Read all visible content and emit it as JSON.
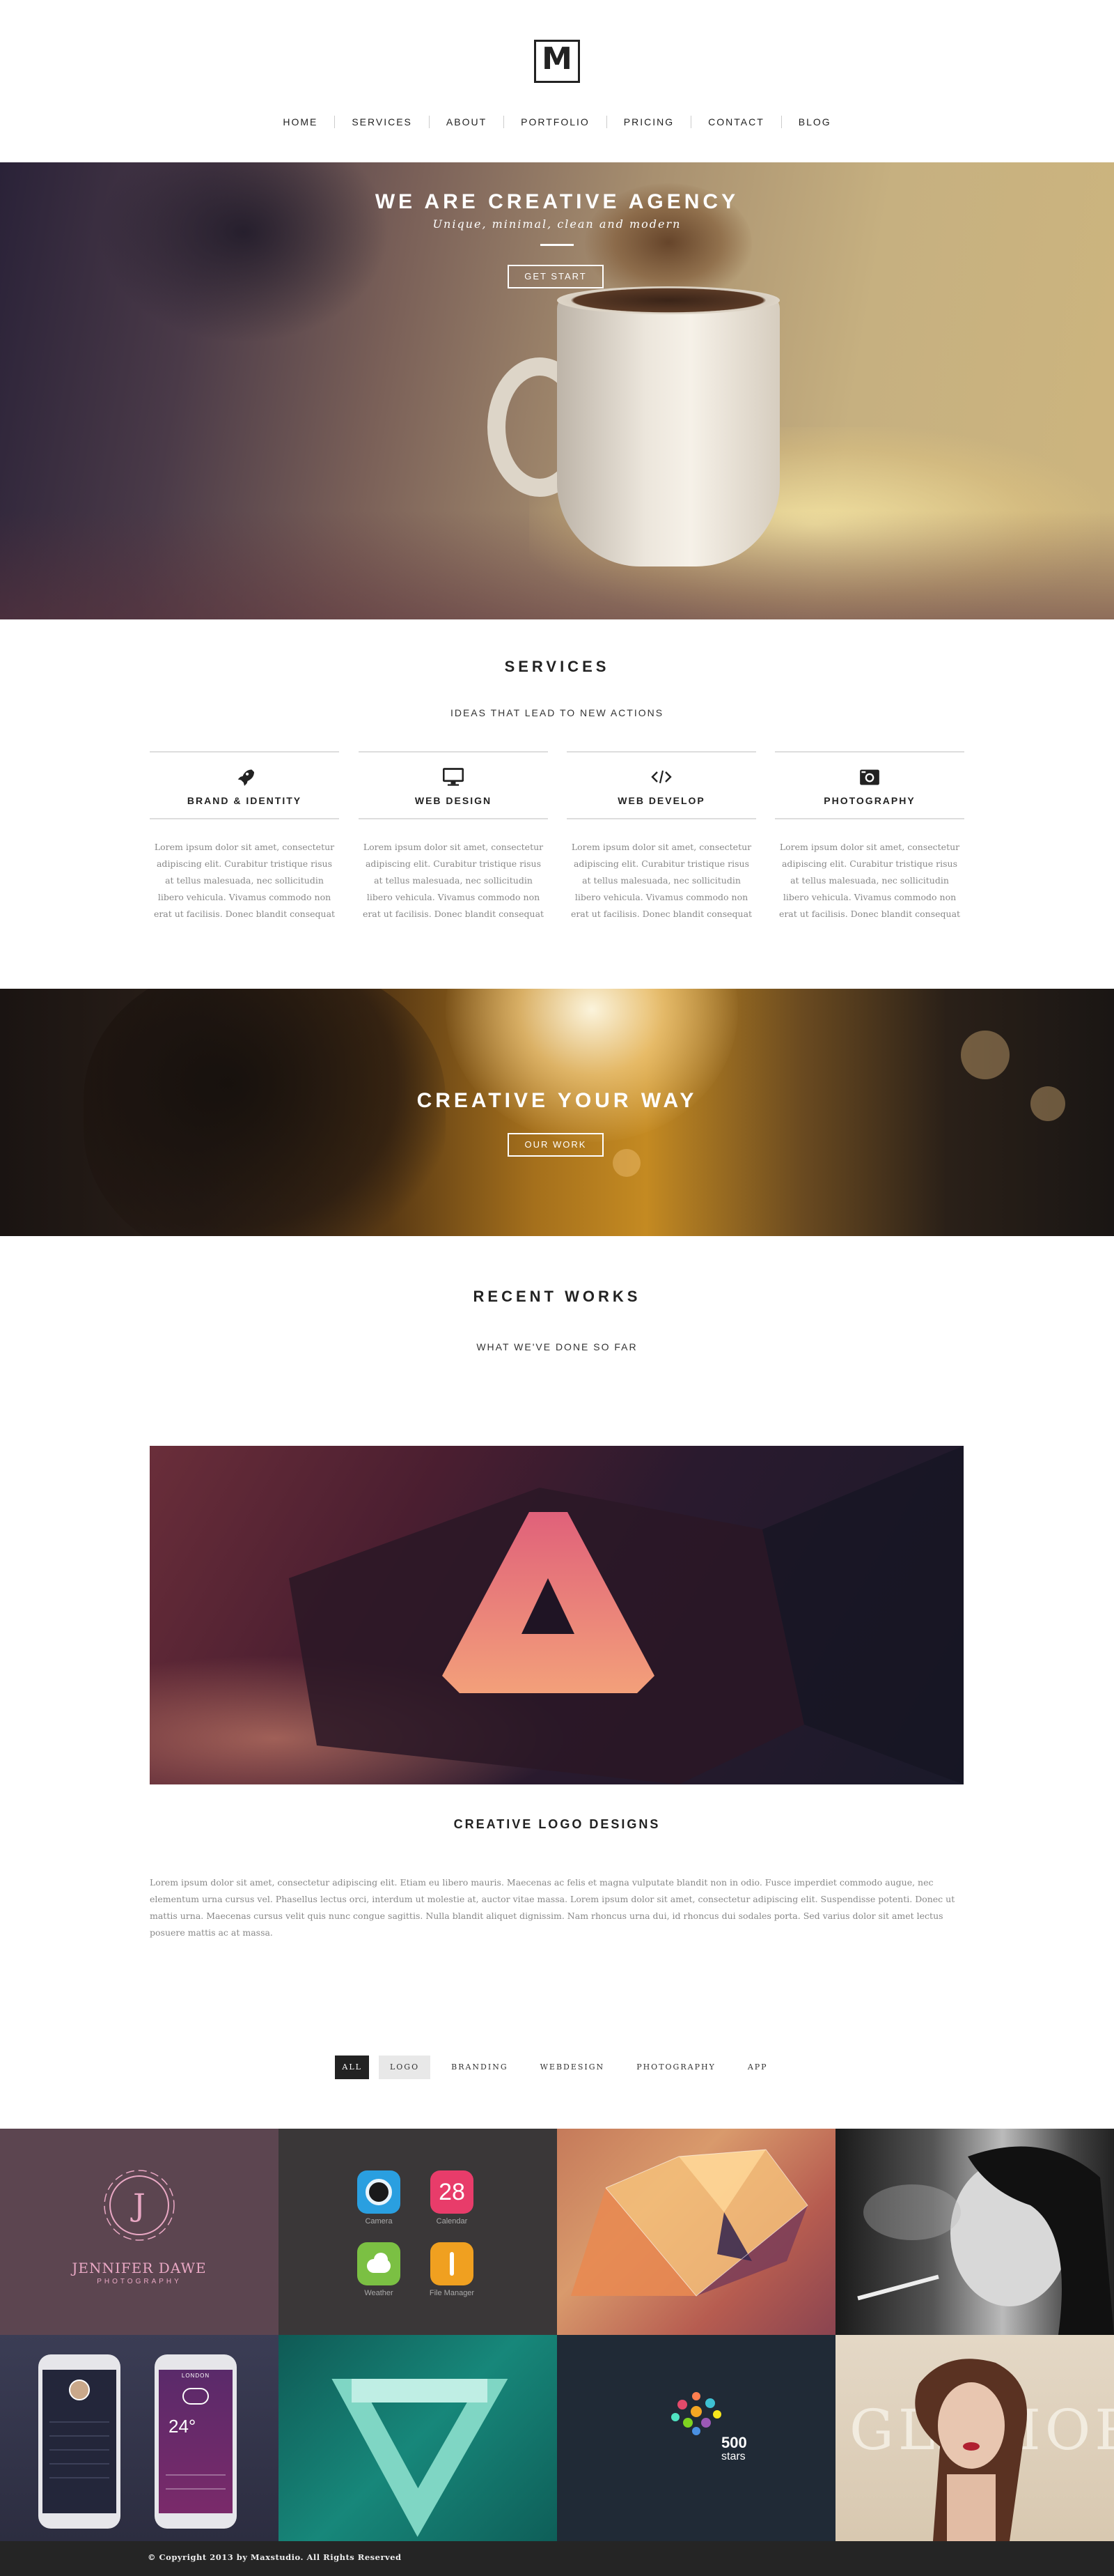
{
  "brand": {
    "logo_letter": "M"
  },
  "nav": {
    "items": [
      "HOME",
      "SERVICES",
      "ABOUT",
      "PORTFOLIO",
      "PRICING",
      "CONTACT",
      "BLOG"
    ]
  },
  "hero": {
    "title": "WE ARE CREATIVE AGENCY",
    "subtitle": "Unique, minimal, clean and modern",
    "button": "GET START"
  },
  "services": {
    "title": "SERVICES",
    "subtitle": "IDEAS THAT LEAD TO NEW ACTIONS",
    "items": [
      {
        "icon": "rocket-icon",
        "name": "BRAND & IDENTITY",
        "text": "Lorem ipsum dolor sit amet, consectetur adipiscing elit. Curabitur tristique risus at tellus malesuada, nec sollicitudin libero vehicula. Vivamus commodo non erat ut facilisis. Donec blandit consequat"
      },
      {
        "icon": "monitor-icon",
        "name": "WEB DESIGN",
        "text": "Lorem ipsum dolor sit amet, consectetur adipiscing elit. Curabitur tristique risus at tellus malesuada, nec sollicitudin libero vehicula. Vivamus commodo non erat ut facilisis. Donec blandit consequat"
      },
      {
        "icon": "code-icon",
        "name": "WEB DEVELOP",
        "text": "Lorem ipsum dolor sit amet, consectetur adipiscing elit. Curabitur tristique risus at tellus malesuada, nec sollicitudin libero vehicula. Vivamus commodo non erat ut facilisis. Donec blandit consequat"
      },
      {
        "icon": "camera-icon",
        "name": "PHOTOGRAPHY",
        "text": "Lorem ipsum dolor sit amet, consectetur adipiscing elit. Curabitur tristique risus at tellus malesuada, nec sollicitudin libero vehicula. Vivamus commodo non erat ut facilisis. Donec blandit consequat"
      }
    ]
  },
  "band": {
    "title": "CREATIVE YOUR WAY",
    "button": "OUR WORK"
  },
  "recent": {
    "title": "RECENT WORKS",
    "subtitle": "WHAT WE'VE DONE SO FAR",
    "feature_title": "CREATIVE LOGO DESIGNS",
    "feature_text": "Lorem ipsum dolor sit amet, consectetur adipiscing elit. Etiam eu libero mauris. Maecenas ac felis et magna vulputate blandit non in odio. Fusce imperdiet commodo augue, nec elementum urna cursus vel. Phasellus lectus orci, interdum ut molestie at, auctor vitae massa. Lorem ipsum dolor sit amet, consectetur adipiscing elit. Suspendisse potenti. Donec ut mattis urna. Maecenas cursus velit quis nunc congue sagittis. Nulla blandit aliquet dignissim. Nam rhoncus urna dui, id rhoncus dui sodales porta. Sed varius dolor sit amet lectus posuere mattis ac at massa."
  },
  "filters": {
    "items": [
      "ALL",
      "LOGO",
      "BRANDING",
      "WEBDESIGN",
      "PHOTOGRAPHY",
      "APP"
    ],
    "active": "ALL"
  },
  "portfolio": {
    "jennifer": {
      "name": "JENNIFER DAWE",
      "tag": "PHOTOGRAPHY"
    },
    "apps": {
      "camera": "Camera",
      "calendar": "Calendar",
      "calendar_day": "28",
      "weather": "Weather",
      "files": "File Manager"
    },
    "phone": {
      "temp": "24°",
      "city": "LONDON"
    },
    "stars": {
      "count": "500",
      "label": "stars"
    },
    "glamour": "GLAMOR."
  },
  "footer": {
    "copyright": "© Copyright 2013 by Maxstudio. All Rights Reserved"
  },
  "colors": {
    "dark": "#222222",
    "footer": "#252525",
    "text_muted": "#888888"
  }
}
